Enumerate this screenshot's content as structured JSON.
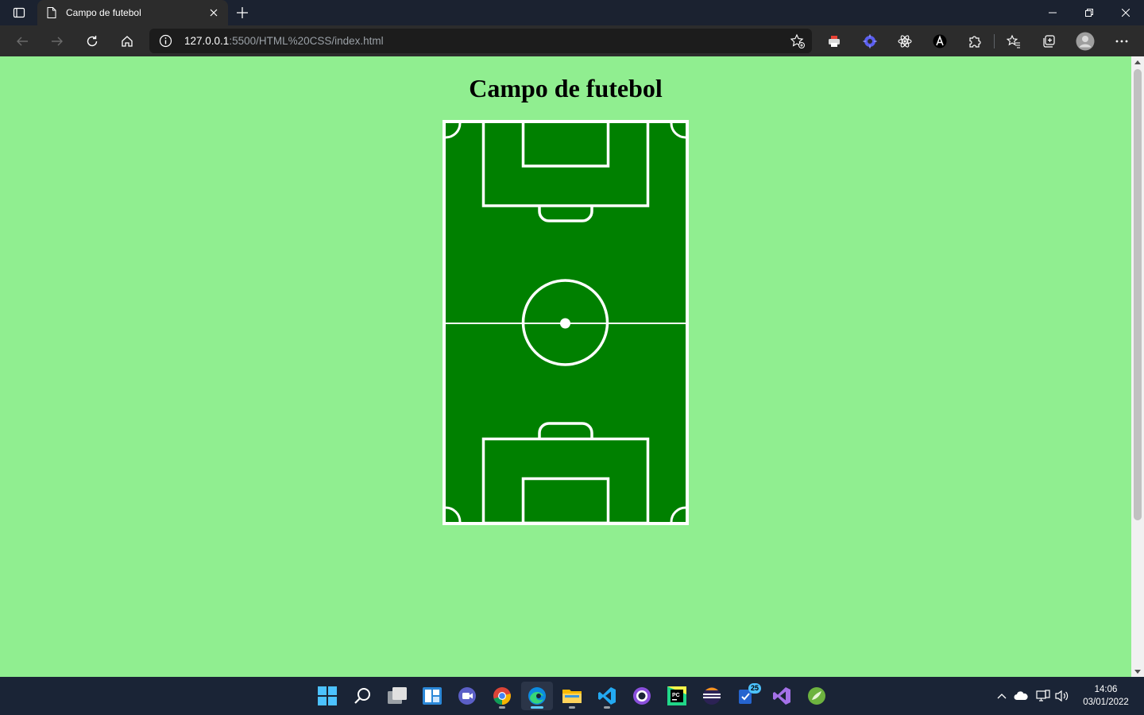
{
  "browser": {
    "tab": {
      "title": "Campo de futebol"
    },
    "address": {
      "host": "127.0.0.1",
      "rest": ":5500/HTML%20CSS/index.html"
    }
  },
  "page": {
    "title": "Campo de futebol"
  },
  "pitch": {
    "grass_color": "#008000",
    "line_color": "#ffffff",
    "background": "#90ee90"
  },
  "taskbar": {
    "pinned": [
      "start-icon",
      "search-icon",
      "task-view-icon",
      "widgets-icon",
      "teams-chat-icon",
      "chrome-icon",
      "edge-icon",
      "file-explorer-icon",
      "vscode-icon",
      "github-desktop-icon",
      "pycharm-icon",
      "eclipse-icon",
      "todo-icon",
      "visual-studio-icon",
      "spring-icon"
    ],
    "todo_badge": "25",
    "clock": {
      "time": "14:06",
      "date": "03/01/2022"
    }
  }
}
